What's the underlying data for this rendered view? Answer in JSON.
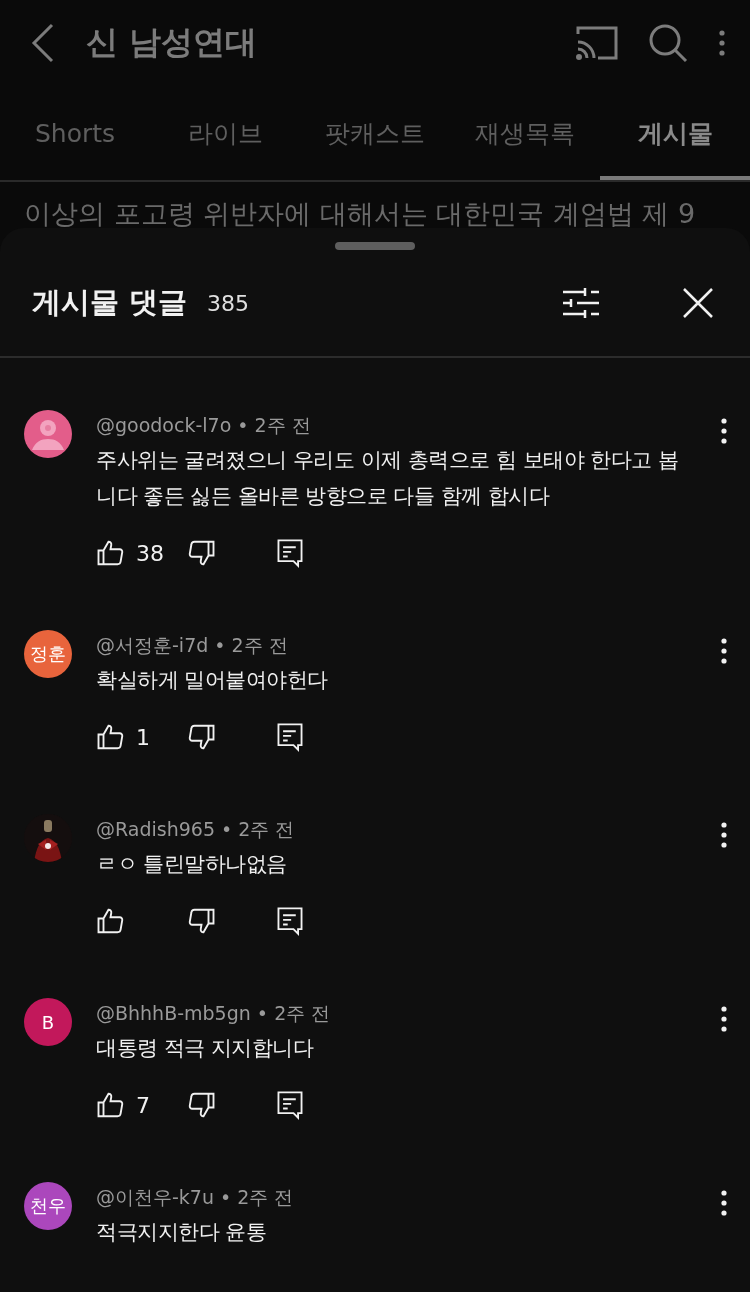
{
  "header": {
    "title": "신 남성연대"
  },
  "tabs": [
    {
      "label": "Shorts",
      "selected": false
    },
    {
      "label": "라이브",
      "selected": false
    },
    {
      "label": "팟캐스트",
      "selected": false
    },
    {
      "label": "재생목록",
      "selected": false
    },
    {
      "label": "게시물",
      "selected": true
    }
  ],
  "post_preview": "이상의 포고령 위반자에 대해서는 대한민국 계엄법 제 9",
  "sheet": {
    "title": "게시물 댓글",
    "count": "385"
  },
  "comments": [
    {
      "avatar": {
        "kind": "default",
        "color": "#e35d8a"
      },
      "author": "@goodock-l7o",
      "separator": "•",
      "time": "2주 전",
      "text": "주사위는 굴려졌으니 우리도 이제 총력으로 힘 보태야 한다고 봅니다 좋든 싫든 올바른 방향으로 다들 함께 합시다",
      "actions": [
        {
          "kind": "like",
          "count": "38"
        },
        {
          "kind": "dislike"
        },
        {
          "kind": "reply"
        }
      ]
    },
    {
      "avatar": {
        "kind": "initials",
        "label": "정훈",
        "color": "#e8643c"
      },
      "author": "@서정훈-i7d",
      "separator": "•",
      "time": "2주 전",
      "text": "확실하게 밀어붙여야헌다",
      "actions": [
        {
          "kind": "like",
          "count": "1"
        },
        {
          "kind": "dislike"
        },
        {
          "kind": "reply"
        }
      ]
    },
    {
      "author": "@Radish965",
      "separator": "•",
      "time": "2주 전",
      "text": "ㄹㅇ 틀린말하나없음",
      "actions": [
        {
          "kind": "like"
        },
        {
          "kind": "dislike"
        },
        {
          "kind": "reply"
        }
      ]
    },
    {
      "avatar": {
        "kind": "initials",
        "label": "B",
        "color": "#c2185b"
      },
      "author": "@BhhhB-mb5gn",
      "separator": "•",
      "time": "2주 전",
      "text": "대통령 적극 지지합니다",
      "actions": [
        {
          "kind": "like",
          "count": "7"
        },
        {
          "kind": "dislike"
        },
        {
          "kind": "reply"
        }
      ]
    },
    {
      "avatar": {
        "kind": "initials",
        "label": "천우",
        "color": "#ab47bc"
      },
      "author": "@이천우-k7u",
      "separator": "•",
      "time": "2주 전",
      "text": "적극지지한다 윤통"
    }
  ]
}
